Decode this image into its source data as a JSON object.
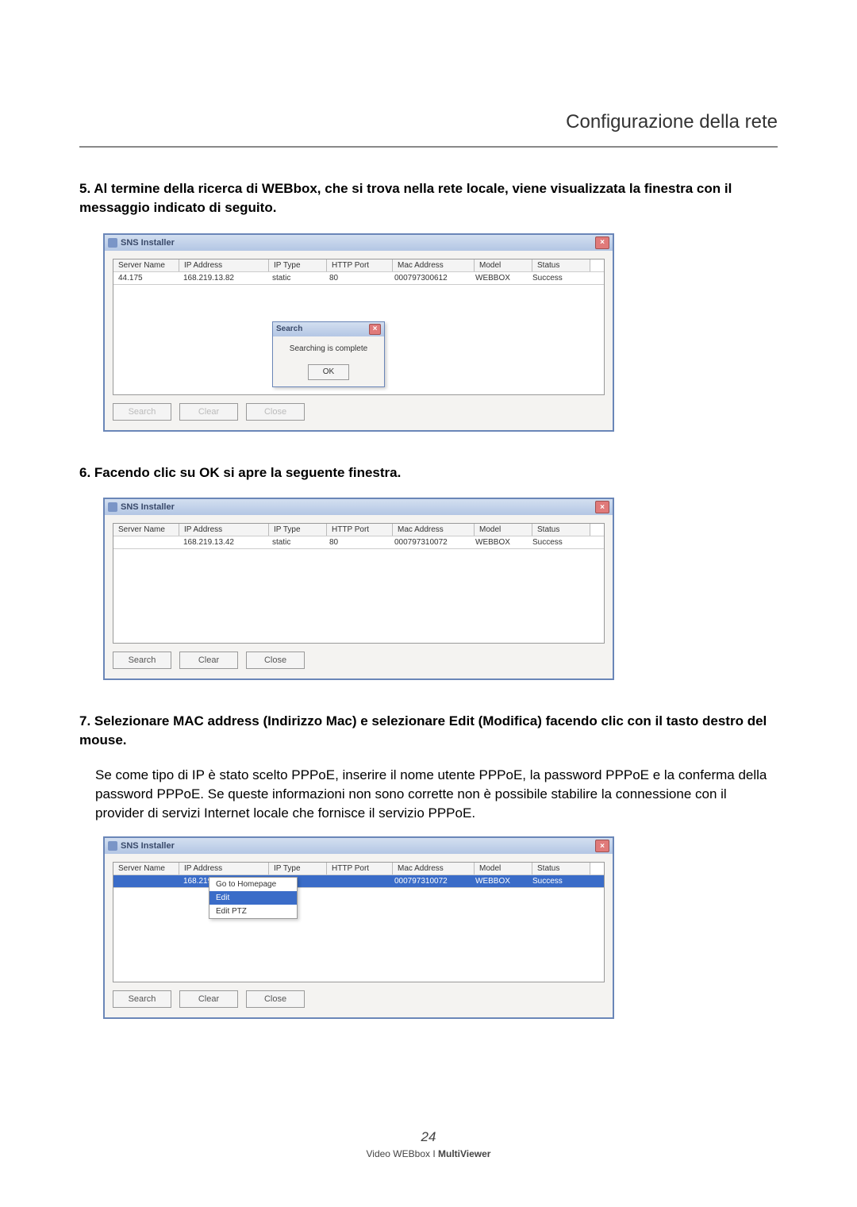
{
  "page": {
    "header": "Configurazione della rete",
    "page_number": "24",
    "product_line": "Video WEBbox I",
    "product_bold": "MultiViewer"
  },
  "steps": {
    "s5_bold": "5. Al termine della ricerca di WEBbox, che si trova nella rete locale, viene visualizzata la finestra con il messaggio indicato di seguito.",
    "s6_bold": "6. Facendo clic su OK si apre la seguente finestra.",
    "s7_bold": "7. Selezionare MAC address (Indirizzo Mac) e selezionare Edit (Modifica) facendo clic con il tasto destro del mouse.",
    "s7_body": "Se come tipo di IP è stato scelto PPPoE, inserire il nome utente PPPoE, la password PPPoE e la conferma della password PPPoE. Se queste informazioni non sono corrette non è possibile stabilire la connessione con il provider di servizi Internet locale che fornisce il servizio PPPoE."
  },
  "window": {
    "title": "SNS Installer",
    "cols": {
      "server": "Server Name",
      "ip": "IP Address",
      "type": "IP Type",
      "port": "HTTP Port",
      "mac": "Mac Address",
      "model": "Model",
      "status": "Status"
    },
    "btn_search": "Search",
    "btn_clear": "Clear",
    "btn_close": "Close"
  },
  "popup": {
    "title": "Search",
    "msg": "Searching is complete",
    "ok": "OK"
  },
  "ctx": {
    "go_home": "Go to Homepage",
    "edit": "Edit",
    "edit_ptz": "Edit PTZ"
  },
  "row1": {
    "server": "44.175",
    "ip": "168.219.13.82",
    "type": "static",
    "port": "80",
    "mac": "000797300612",
    "model": "WEBBOX",
    "status": "Success"
  },
  "row2": {
    "server": "",
    "ip": "168.219.13.42",
    "type": "static",
    "port": "80",
    "mac": "000797310072",
    "model": "WEBBOX",
    "status": "Success"
  },
  "row3": {
    "server": "",
    "ip": "168.219.13",
    "type": "",
    "port": "",
    "mac": "000797310072",
    "model": "WEBBOX",
    "status": "Success"
  }
}
